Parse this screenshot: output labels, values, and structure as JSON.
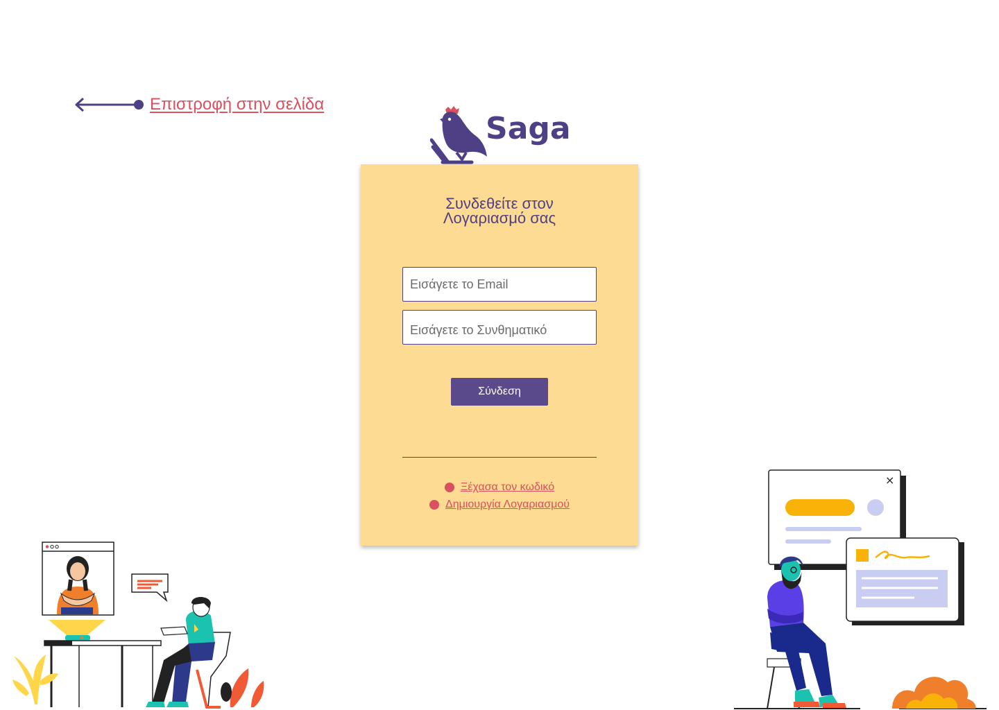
{
  "back": {
    "label": "Επιστροφή στην σελίδα",
    "icon": "arrow-left-icon"
  },
  "logo": {
    "text": "Saga",
    "icon": "bird-logo-icon"
  },
  "login": {
    "title_line1": "Συνδεθείτε στον",
    "title_line2": "Λογαριασμό σας",
    "email_placeholder": "Εισάγετε το Email",
    "password_placeholder": "Εισάγετε το Συνθηματικό",
    "submit_label": "Σύνδεση",
    "forgot_label": "Ξέχασα τον κωδικό",
    "create_label": "Δημιουργία Λογαριασμού"
  },
  "illustration_left": {
    "window_close_glyph": ""
  },
  "illustration_right": {
    "close_glyph": "×"
  },
  "colors": {
    "brand_purple": "#4f3f85",
    "button_purple": "#5a4a8c",
    "accent_red": "#d9505f",
    "card_bg": "#fddb93"
  }
}
